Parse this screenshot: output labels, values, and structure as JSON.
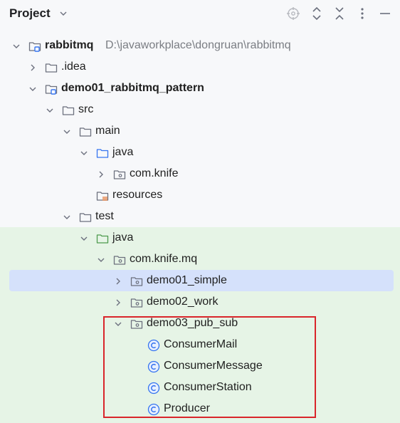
{
  "header": {
    "title": "Project",
    "icons": [
      "locate-icon",
      "expand-all-icon",
      "collapse-all-icon",
      "more-icon",
      "minimize-icon"
    ]
  },
  "tree": [
    {
      "label": "rabbitmq",
      "bold": true,
      "path": "D:\\javaworkplace\\dongruan\\rabbitmq",
      "icon": "module-folder",
      "expanded": true
    },
    {
      "label": ".idea",
      "icon": "folder",
      "expanded": false
    },
    {
      "label": "demo01_rabbitmq_pattern",
      "bold": true,
      "icon": "module-folder",
      "expanded": true
    },
    {
      "label": "src",
      "icon": "folder",
      "expanded": true
    },
    {
      "label": "main",
      "icon": "folder",
      "expanded": true
    },
    {
      "label": "java",
      "icon": "source-folder",
      "expanded": true
    },
    {
      "label": "com.knife",
      "icon": "package",
      "expanded": false
    },
    {
      "label": "resources",
      "icon": "resources-folder"
    },
    {
      "label": "test",
      "icon": "folder",
      "expanded": true
    },
    {
      "label": "java",
      "icon": "test-folder",
      "expanded": true
    },
    {
      "label": "com.knife.mq",
      "icon": "package",
      "expanded": true
    },
    {
      "label": "demo01_simple",
      "icon": "package",
      "expanded": false,
      "selected": true
    },
    {
      "label": "demo02_work",
      "icon": "package",
      "expanded": false
    },
    {
      "label": "demo03_pub_sub",
      "icon": "package",
      "expanded": true
    },
    {
      "label": "ConsumerMail",
      "icon": "class"
    },
    {
      "label": "ConsumerMessage",
      "icon": "class"
    },
    {
      "label": "ConsumerStation",
      "icon": "class"
    },
    {
      "label": "Producer",
      "icon": "class"
    }
  ]
}
